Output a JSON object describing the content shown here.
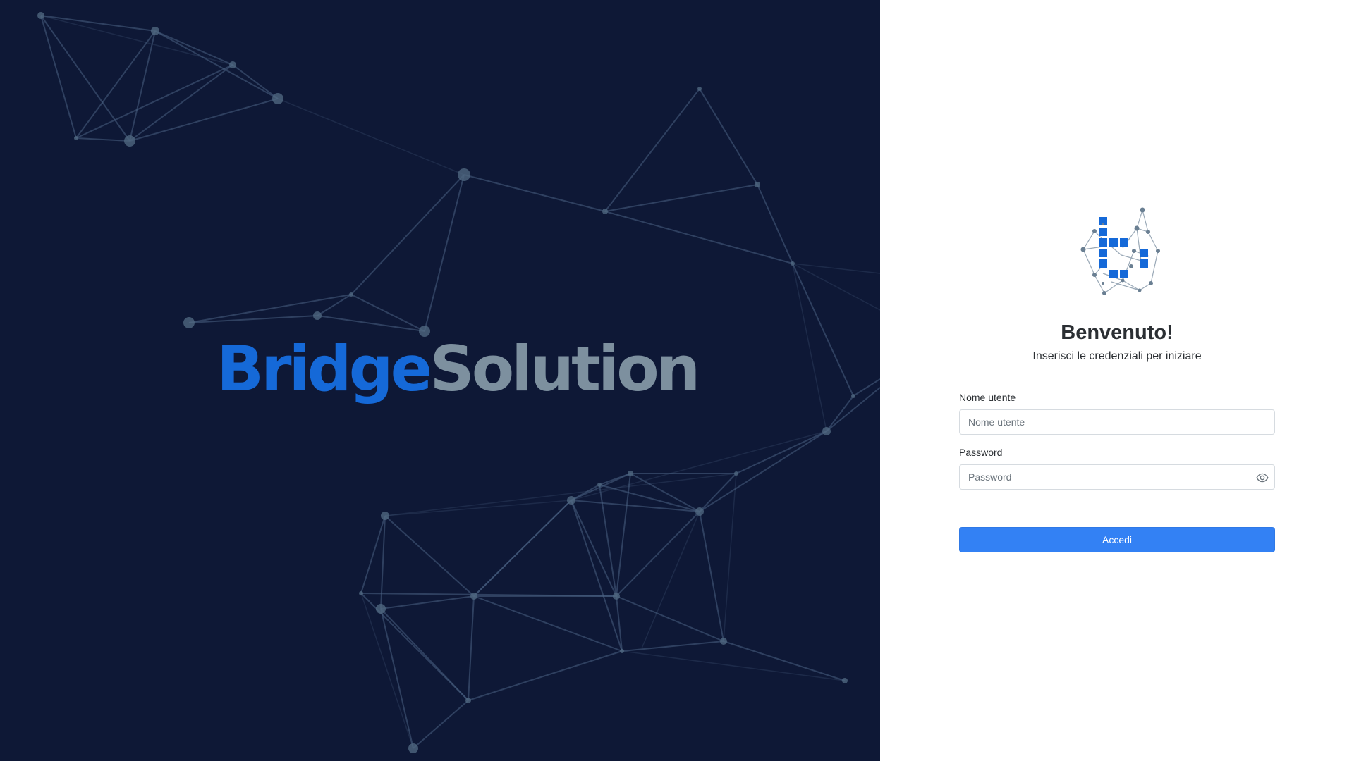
{
  "brand": {
    "name_part_1": "Bridge",
    "name_part_2": "Solution"
  },
  "login": {
    "title": "Benvenuto!",
    "subtitle": "Inserisci le credenziali per iniziare",
    "username": {
      "label": "Nome utente",
      "placeholder": "Nome utente",
      "value": ""
    },
    "password": {
      "label": "Password",
      "placeholder": "Password",
      "value": "",
      "toggle_icon": "eye-icon"
    },
    "submit_label": "Accedi"
  },
  "colors": {
    "left_background": "#0e1836",
    "brand_primary": "#1569d8",
    "brand_secondary": "#7d909f",
    "button": "#3381f4"
  },
  "icons": {
    "logo": "network-blocks-logo",
    "background": "network-graph-pattern"
  }
}
